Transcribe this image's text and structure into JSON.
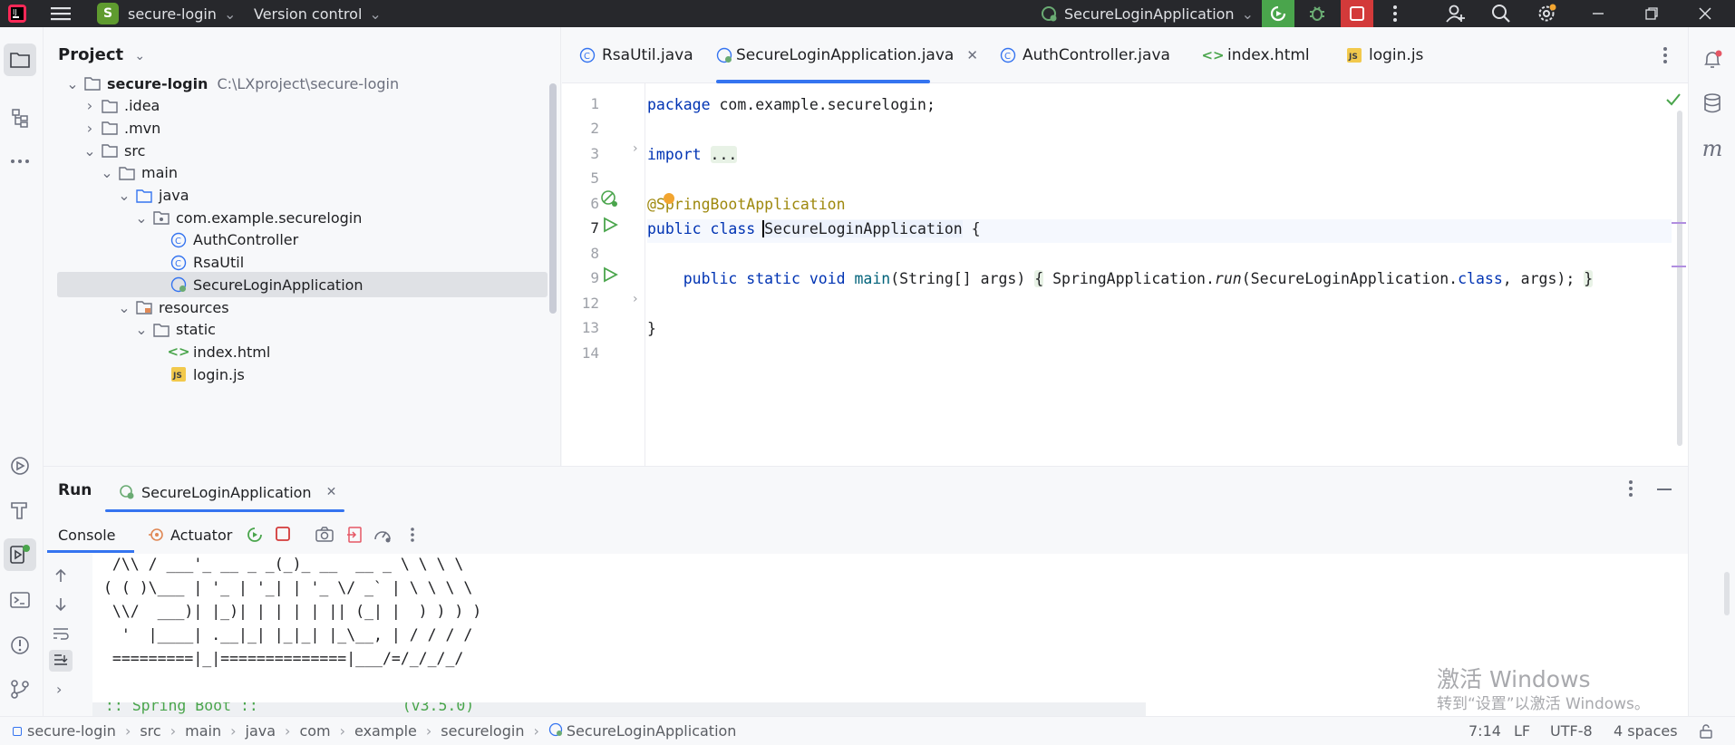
{
  "titlebar": {
    "project_initial": "S",
    "project_name": "secure-login",
    "vcs_label": "Version control",
    "run_config": "SecureLoginApplication"
  },
  "project_panel": {
    "title": "Project",
    "tree": [
      {
        "label": "secure-login",
        "path": "C:\\LXproject\\secure-login",
        "icon": "folder-icon",
        "expanded": true
      },
      {
        "label": ".idea",
        "icon": "folder-icon",
        "expanded": false
      },
      {
        "label": ".mvn",
        "icon": "folder-icon",
        "expanded": false
      },
      {
        "label": "src",
        "icon": "folder-icon",
        "expanded": true
      },
      {
        "label": "main",
        "icon": "folder-icon",
        "expanded": true
      },
      {
        "label": "java",
        "icon": "source-folder-icon",
        "expanded": true
      },
      {
        "label": "com.example.securelogin",
        "icon": "package-icon",
        "expanded": true
      },
      {
        "label": "AuthController",
        "icon": "class-icon"
      },
      {
        "label": "RsaUtil",
        "icon": "class-icon"
      },
      {
        "label": "SecureLoginApplication",
        "icon": "spring-class-icon",
        "selected": true
      },
      {
        "label": "resources",
        "icon": "resources-folder-icon",
        "expanded": true
      },
      {
        "label": "static",
        "icon": "folder-icon",
        "expanded": true
      },
      {
        "label": "index.html",
        "icon": "html-file-icon"
      },
      {
        "label": "login.js",
        "icon": "js-file-icon"
      }
    ]
  },
  "editor": {
    "tabs": [
      {
        "label": "RsaUtil.java",
        "icon": "class-icon"
      },
      {
        "label": "SecureLoginApplication.java",
        "icon": "spring-class-icon",
        "active": true
      },
      {
        "label": "AuthController.java",
        "icon": "class-icon"
      },
      {
        "label": "index.html",
        "icon": "html-file-icon"
      },
      {
        "label": "login.js",
        "icon": "js-file-icon"
      }
    ],
    "line_numbers": [
      "1",
      "2",
      "3",
      "5",
      "6",
      "7",
      "8",
      "9",
      "12",
      "13",
      "14"
    ],
    "code": {
      "l1_kw": "package",
      "l1_rest": " com.example.securelogin;",
      "l3_kw": "import",
      "l3_fold": "...",
      "l6_ann": "@SpringBootApplication",
      "l7_kw": "public class",
      "l7_name": "SecureLoginApplication",
      "l7_rest": " {",
      "l9_kw": "public static void",
      "l9_fn": "main",
      "l9_params": "(String[] args) ",
      "l9_open": "{",
      "l9_body1": " SpringApplication.",
      "l9_run": "run",
      "l9_body2": "(SecureLoginApplication.",
      "l9_class": "class",
      "l9_body3": ", args); ",
      "l9_close": "}",
      "l13": "}"
    }
  },
  "run_panel": {
    "title": "Run",
    "config_tab": "SecureLoginApplication",
    "console_tab": "Console",
    "actuator_tab": "Actuator",
    "banner": [
      " /\\\\ / ___'_ __ _ _(_)_ __  __ _ \\ \\ \\ \\",
      "( ( )\\___ | '_ | '_| | '_ \\/ _` | \\ \\ \\ \\",
      " \\\\/  ___)| |_)| | | | | || (_| |  ) ) ) )",
      "  '  |____| .__|_| |_|_| |_\\__, | / / / /",
      " =========|_|==============|___/=/_/_/_/"
    ],
    "spring_line": " :: Spring Boot ::                (v3.5.0)"
  },
  "statusbar": {
    "breadcrumbs": [
      "secure-login",
      "src",
      "main",
      "java",
      "com",
      "example",
      "securelogin",
      "SecureLoginApplication"
    ],
    "position": "7:14",
    "line_ending": "LF",
    "encoding": "UTF-8",
    "indent": "4 spaces"
  },
  "watermark": {
    "line1": "激活 Windows",
    "line2": "转到“设置”以激活 Windows。"
  }
}
